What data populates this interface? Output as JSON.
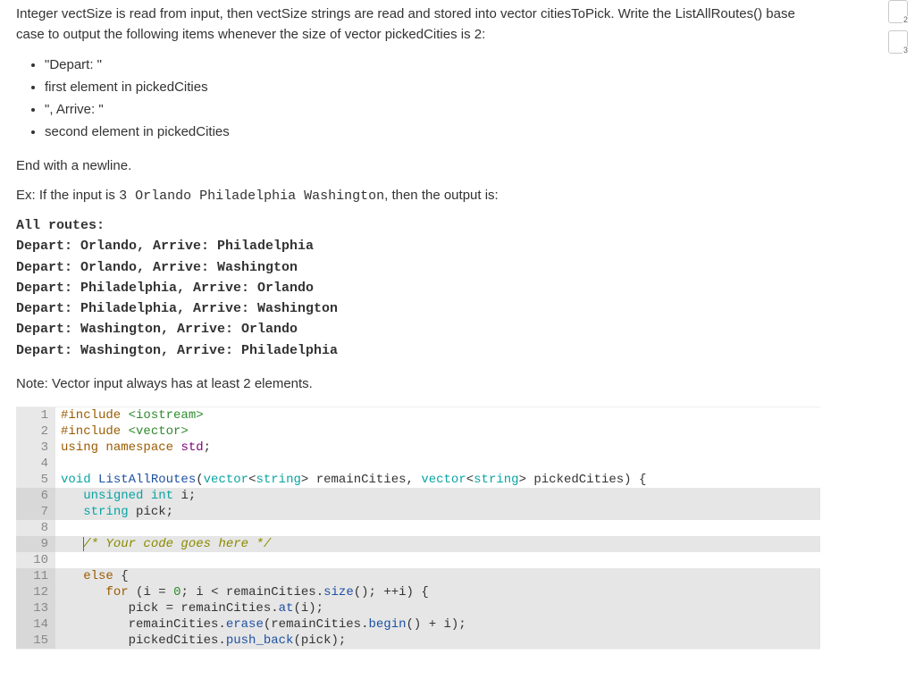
{
  "prompt": {
    "intro_pre": "Integer vectSize is read from input, then vectSize strings are read and stored into vector citiesToPick. Write the ListAllRoutes() base case to output the following items whenever the size of vector pickedCities is 2:",
    "bullets": [
      "\"Depart: \"",
      "first element in pickedCities",
      "\", Arrive: \"",
      "second element in pickedCities"
    ],
    "end_line": "End with a newline.",
    "ex_pre": "Ex: If the input is ",
    "ex_input": "3 Orlando Philadelphia Washington",
    "ex_post": ", then the output is:",
    "output_lines": [
      "All routes:",
      "Depart: Orlando, Arrive: Philadelphia",
      "Depart: Orlando, Arrive: Washington",
      "Depart: Philadelphia, Arrive: Orlando",
      "Depart: Philadelphia, Arrive: Washington",
      "Depart: Washington, Arrive: Orlando",
      "Depart: Washington, Arrive: Philadelphia"
    ],
    "note": "Note: Vector input always has at least 2 elements."
  },
  "code": {
    "lines": [
      {
        "n": 1,
        "hl": false,
        "html": "<span class='kw'>#include</span> <span class='st'>&lt;iostream&gt;</span>"
      },
      {
        "n": 2,
        "hl": false,
        "html": "<span class='kw'>#include</span> <span class='st'>&lt;vector&gt;</span>"
      },
      {
        "n": 3,
        "hl": false,
        "html": "<span class='kw'>using</span> <span class='kw'>namespace</span> <span class='ns'>std</span>;"
      },
      {
        "n": 4,
        "hl": false,
        "html": ""
      },
      {
        "n": 5,
        "hl": false,
        "html": "<span class='ty'>void</span> <span class='fn'>ListAllRoutes</span>(<span class='ty'>vector</span>&lt;<span class='ty'>string</span>&gt; remainCities, <span class='ty'>vector</span>&lt;<span class='ty'>string</span>&gt; pickedCities) {"
      },
      {
        "n": 6,
        "hl": true,
        "html": "   <span class='ty'>unsigned int</span> i;"
      },
      {
        "n": 7,
        "hl": true,
        "html": "   <span class='ty'>string</span> pick;"
      },
      {
        "n": 8,
        "hl": false,
        "html": ""
      },
      {
        "n": 9,
        "hl": true,
        "html": "   <span class='cursor'></span><span class='cm'>/* Your code goes here */</span>"
      },
      {
        "n": 10,
        "hl": false,
        "html": ""
      },
      {
        "n": 11,
        "hl": true,
        "html": "   <span class='kw'>else</span> {"
      },
      {
        "n": 12,
        "hl": true,
        "html": "      <span class='kw'>for</span> (i = <span class='num'>0</span>; i &lt; remainCities.<span class='fn'>size</span>(); ++i) {"
      },
      {
        "n": 13,
        "hl": true,
        "html": "         pick = remainCities.<span class='fn'>at</span>(i);"
      },
      {
        "n": 14,
        "hl": true,
        "html": "         remainCities.<span class='fn'>erase</span>(remainCities.<span class='fn'>begin</span>() + i);"
      },
      {
        "n": 15,
        "hl": true,
        "html": "         pickedCities.<span class='fn'>push_back</span>(pick);"
      }
    ]
  },
  "feedback": {
    "items": [
      {
        "label": "2"
      },
      {
        "label": "3"
      }
    ]
  }
}
